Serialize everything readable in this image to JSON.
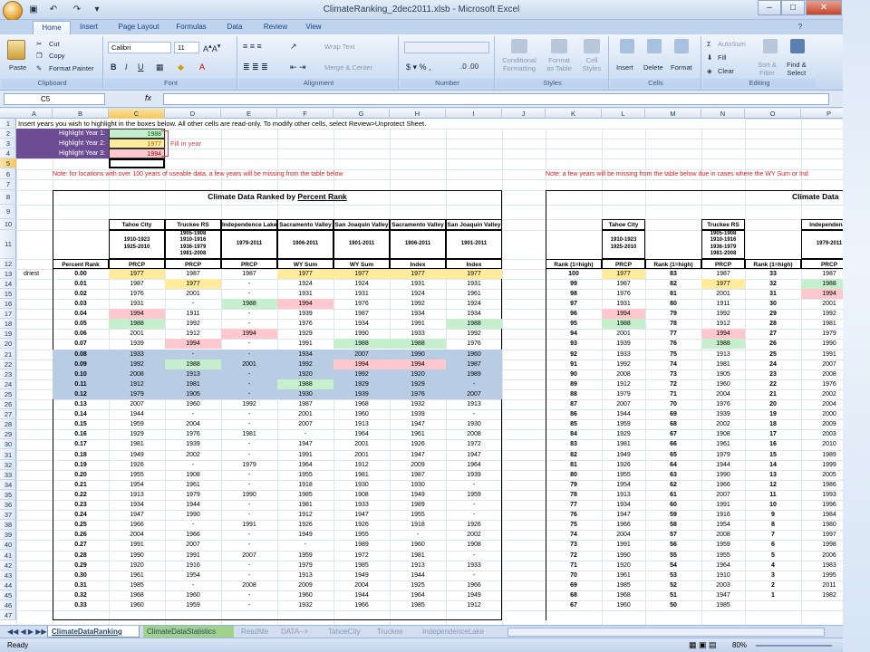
{
  "window": {
    "title": "ClimateRanking_2dec2011.xlsb - Microsoft Excel",
    "min": "–",
    "max": "□",
    "close": "✕"
  },
  "tabs": [
    "Home",
    "Insert",
    "Page Layout",
    "Formulas",
    "Data",
    "Review",
    "View"
  ],
  "ribbon": {
    "clipboard": {
      "label": "Clipboard",
      "paste": "Paste",
      "cut": "Cut",
      "copy": "Copy",
      "painter": "Format Painter"
    },
    "font": {
      "label": "Font",
      "name": "Calibri",
      "size": "11"
    },
    "alignment": {
      "label": "Alignment",
      "wrap": "Wrap Text",
      "merge": "Merge & Center"
    },
    "number": {
      "label": "Number"
    },
    "styles": {
      "label": "Styles",
      "cond": [
        "Conditional",
        "Formatting"
      ],
      "table": [
        "Format",
        "as Table"
      ],
      "cell": [
        "Cell",
        "Styles"
      ]
    },
    "cells": {
      "label": "Cells",
      "insert": "Insert",
      "delete": "Delete",
      "format": "Format"
    },
    "editing": {
      "label": "Editing",
      "autosum": "AutoSum",
      "fill": "Fill",
      "clear": "Clear",
      "sort": [
        "Sort &",
        "Filter"
      ],
      "find": [
        "Find &",
        "Select"
      ]
    }
  },
  "formula_bar": {
    "namebox": "C5",
    "fx": "fx",
    "value": ""
  },
  "columns": [
    "A",
    "B",
    "C",
    "D",
    "E",
    "F",
    "G",
    "H",
    "I",
    "J",
    "K",
    "L",
    "M",
    "N",
    "O",
    "P"
  ],
  "sheet": {
    "instructions": "Insert years you wish to highlight in the boxes below.  All other cells are read-only. To modify other cells, select Review>Unprotect Sheet.",
    "highlights": [
      {
        "label": "Highlight Year 1:",
        "value": "1988"
      },
      {
        "label": "Highlight Year 2:",
        "value": "1977"
      },
      {
        "label": "Highlight Year 3:",
        "value": "1994"
      }
    ],
    "fill_note": "Fill in year",
    "note_left": "Note: for locations with over 100 years of useable data, a few years will be missing from the table below",
    "note_right": "Note: a few years will be missing from the table below due in cases where the WY Sum or Ind",
    "title_left": "Climate Data Ranked by ",
    "title_left_u": "Percent Rank",
    "title_right": "Climate Data",
    "stations": [
      "Tahoe City",
      "Truckee RS",
      "Independence Lake",
      "Sacramento Valley",
      "San Joaquin Valley",
      "Sacramento Valley",
      "San Joaquin Valley"
    ],
    "periods": [
      "1910-1923\n1925-2010",
      "1905-1908\n1910-1916\n1936-1979\n1981-2008",
      "1979-2011",
      "1906-2011",
      "1901-2011",
      "1906-2011",
      "1901-2011"
    ],
    "subhdr": [
      "Percent Rank",
      "PRCP",
      "PRCP",
      "PRCP",
      "WY Sum",
      "WY Sum",
      "Index",
      "Index"
    ],
    "right_stations": [
      "Tahoe City",
      "Truckee RS",
      "Independence"
    ],
    "right_periods": [
      "1910-1923\n1925-2010",
      "1905-1908\n1910-1916\n1936-1979\n1981-2008",
      "1979-2011"
    ],
    "right_subhdr": [
      "Rank (1=high)",
      "PRCP",
      "Rank (1=high)",
      "PRCP",
      "Rank (1=high)",
      "PRCP"
    ],
    "driest": "driest",
    "rows": [
      [
        "0.00",
        "1977",
        "1987",
        "1987",
        "1977",
        "1977",
        "1977",
        "1977",
        "100",
        "1977",
        "83",
        "1987",
        "33",
        "1987"
      ],
      [
        "0.01",
        "1987",
        "1977",
        "-",
        "1924",
        "1924",
        "1931",
        "1931",
        "99",
        "1987",
        "82",
        "1977",
        "32",
        "1988"
      ],
      [
        "0.02",
        "1976",
        "2001",
        "-",
        "1931",
        "1931",
        "1924",
        "1961",
        "98",
        "1976",
        "81",
        "2001",
        "31",
        "1994"
      ],
      [
        "0.03",
        "1931",
        "-",
        "1988",
        "1994",
        "1976",
        "1992",
        "1924",
        "97",
        "1931",
        "80",
        "1911",
        "30",
        "2001"
      ],
      [
        "0.04",
        "1994",
        "1911",
        "-",
        "1939",
        "1987",
        "1934",
        "1934",
        "96",
        "1994",
        "79",
        "1992",
        "29",
        "1992"
      ],
      [
        "0.05",
        "1988",
        "1992",
        "-",
        "1976",
        "1934",
        "1991",
        "1988",
        "95",
        "1988",
        "78",
        "1912",
        "28",
        "1981"
      ],
      [
        "0.06",
        "2001",
        "1912",
        "1994",
        "1929",
        "1990",
        "1933",
        "1992",
        "94",
        "2001",
        "77",
        "1994",
        "27",
        "1979"
      ],
      [
        "0.07",
        "1939",
        "1994",
        "-",
        "1991",
        "1988",
        "1988",
        "1976",
        "93",
        "1939",
        "76",
        "1988",
        "26",
        "1990"
      ],
      [
        "0.08",
        "1933",
        "-",
        "-",
        "1934",
        "2007",
        "1990",
        "1960",
        "92",
        "1933",
        "75",
        "1913",
        "25",
        "1991"
      ],
      [
        "0.09",
        "1992",
        "1988",
        "2001",
        "1992",
        "1994",
        "1994",
        "1987",
        "91",
        "1992",
        "74",
        "1981",
        "24",
        "2007"
      ],
      [
        "0.10",
        "2008",
        "1913",
        "-",
        "1920",
        "1992",
        "1920",
        "1989",
        "90",
        "2008",
        "73",
        "1905",
        "23",
        "2008"
      ],
      [
        "0.11",
        "1912",
        "1981",
        "-",
        "1988",
        "1929",
        "1929",
        "-",
        "89",
        "1912",
        "72",
        "1960",
        "22",
        "1976"
      ],
      [
        "0.12",
        "1979",
        "1905",
        "-",
        "1930",
        "1939",
        "1976",
        "2007",
        "88",
        "1979",
        "71",
        "2004",
        "21",
        "2002"
      ],
      [
        "0.13",
        "2007",
        "1960",
        "1992",
        "1987",
        "1968",
        "1932",
        "1913",
        "87",
        "2007",
        "70",
        "1976",
        "20",
        "2004"
      ],
      [
        "0.14",
        "1944",
        "-",
        "-",
        "2001",
        "1960",
        "1939",
        "-",
        "86",
        "1944",
        "69",
        "1939",
        "19",
        "2000"
      ],
      [
        "0.15",
        "1959",
        "2004",
        "-",
        "2007",
        "1913",
        "1947",
        "1930",
        "85",
        "1959",
        "68",
        "2002",
        "18",
        "2009"
      ],
      [
        "0.16",
        "1929",
        "1976",
        "1981",
        "-",
        "1964",
        "1961",
        "2008",
        "84",
        "1929",
        "67",
        "1908",
        "17",
        "2003"
      ],
      [
        "0.17",
        "1981",
        "1939",
        "-",
        "1947",
        "2001",
        "1926",
        "1972",
        "83",
        "1981",
        "66",
        "1961",
        "16",
        "2010"
      ],
      [
        "0.18",
        "1949",
        "2002",
        "-",
        "1991",
        "2001",
        "1947",
        "1947",
        "82",
        "1949",
        "65",
        "1979",
        "15",
        "1989"
      ],
      [
        "0.19",
        "1926",
        "-",
        "1979",
        "1964",
        "1912",
        "2009",
        "1964",
        "81",
        "1926",
        "64",
        "1944",
        "14",
        "1999"
      ],
      [
        "0.20",
        "1955",
        "1908",
        "-",
        "1955",
        "1981",
        "1987",
        "1939",
        "80",
        "1955",
        "63",
        "1990",
        "13",
        "2005"
      ],
      [
        "0.21",
        "1954",
        "1961",
        "-",
        "1918",
        "1930",
        "1930",
        "-",
        "79",
        "1954",
        "62",
        "1966",
        "12",
        "1986"
      ],
      [
        "0.22",
        "1913",
        "1979",
        "1990",
        "1985",
        "1908",
        "1949",
        "1959",
        "78",
        "1913",
        "61",
        "2007",
        "11",
        "1993"
      ],
      [
        "0.23",
        "1934",
        "1944",
        "-",
        "1981",
        "1933",
        "1989",
        "-",
        "77",
        "1934",
        "60",
        "1991",
        "10",
        "1996"
      ],
      [
        "0.24",
        "1947",
        "1990",
        "-",
        "1912",
        "1947",
        "1955",
        "-",
        "76",
        "1947",
        "59",
        "1916",
        "9",
        "1984"
      ],
      [
        "0.25",
        "1966",
        "-",
        "1991",
        "1926",
        "1926",
        "1918",
        "1926",
        "75",
        "1966",
        "58",
        "1954",
        "8",
        "1980"
      ],
      [
        "0.26",
        "2004",
        "1966",
        "-",
        "1949",
        "1955",
        "-",
        "2002",
        "74",
        "2004",
        "57",
        "2008",
        "7",
        "1997"
      ],
      [
        "0.27",
        "1991",
        "2007",
        "-",
        "-",
        "1989",
        "1960",
        "1908",
        "73",
        "1991",
        "56",
        "1959",
        "6",
        "1998"
      ],
      [
        "0.28",
        "1990",
        "1991",
        "2007",
        "1959",
        "1972",
        "1981",
        "-",
        "72",
        "1990",
        "55",
        "1955",
        "5",
        "2006"
      ],
      [
        "0.29",
        "1920",
        "1916",
        "-",
        "1979",
        "1985",
        "1913",
        "1933",
        "71",
        "1920",
        "54",
        "1964",
        "4",
        "1983"
      ],
      [
        "0.30",
        "1961",
        "1954",
        "-",
        "1913",
        "1949",
        "1944",
        "-",
        "70",
        "1961",
        "53",
        "1910",
        "3",
        "1995"
      ],
      [
        "0.31",
        "1985",
        "-",
        "2008",
        "2009",
        "2004",
        "1925",
        "1966",
        "69",
        "1985",
        "52",
        "2003",
        "2",
        "2011"
      ],
      [
        "0.32",
        "1968",
        "1960",
        "-",
        "1960",
        "1944",
        "1964",
        "1949",
        "68",
        "1968",
        "51",
        "1947",
        "1",
        "1982"
      ],
      [
        "0.33",
        "1960",
        "1959",
        "-",
        "1932",
        "1966",
        "1985",
        "1912",
        "67",
        "1960",
        "50",
        "1985",
        "",
        ""
      ]
    ]
  },
  "sheet_tabs": [
    "ClimateDataRanking",
    "ClimateDataStatistics",
    "ReadMe",
    "DATA-->",
    "TahoeCity",
    "Truckee",
    "IndependenceLake"
  ],
  "status": {
    "text": "Ready",
    "zoom": "80%"
  },
  "colors": {
    "hl_purple": "#6c4d94",
    "green": "#c6efce",
    "yellow": "#ffeb9c",
    "pink": "#ffc7ce",
    "blue_band": "#b8cce4"
  }
}
